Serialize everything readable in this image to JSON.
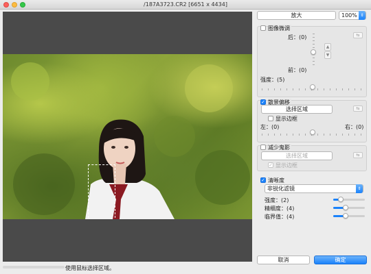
{
  "window": {
    "title": "/187A3723.CR2 [6651 x 4434]"
  },
  "status": {
    "text": "使用鼠标选择区域。"
  },
  "toolbar": {
    "zoom_button": "放大",
    "zoom_value": "100%"
  },
  "image_adjust": {
    "label": "图像微调",
    "checked": false,
    "back_label": "后：(0)",
    "front_label": "前：(0)",
    "strength_label": "强度：(5)",
    "strength_level": 0.5,
    "icon": "adjust-icon"
  },
  "bokeh_shift": {
    "label": "散景偏移",
    "checked": true,
    "select_area_button": "选择区域",
    "show_border_label": "显示边框",
    "show_border_checked": false,
    "left_label": "左：(0)",
    "right_label": "右：(0)",
    "balance_level": 0.5
  },
  "ghost_reduction": {
    "label": "减少鬼影",
    "checked": false,
    "select_area_button": "选择区域",
    "show_border_label": "显示边框",
    "show_border_checked": true
  },
  "sharpness": {
    "label": "清晰度",
    "checked": true,
    "filter_value": "非锐化滤镜",
    "strength_label": "强度：(2)",
    "strength_level": 0.2,
    "fineness_label": "精细度：(4)",
    "fineness_level": 0.4,
    "threshold_label": "临界值：(4)",
    "threshold_level": 0.4
  },
  "footer": {
    "cancel_button": "取消",
    "ok_button": "确定"
  },
  "colors": {
    "accent": "#1a82fb"
  }
}
